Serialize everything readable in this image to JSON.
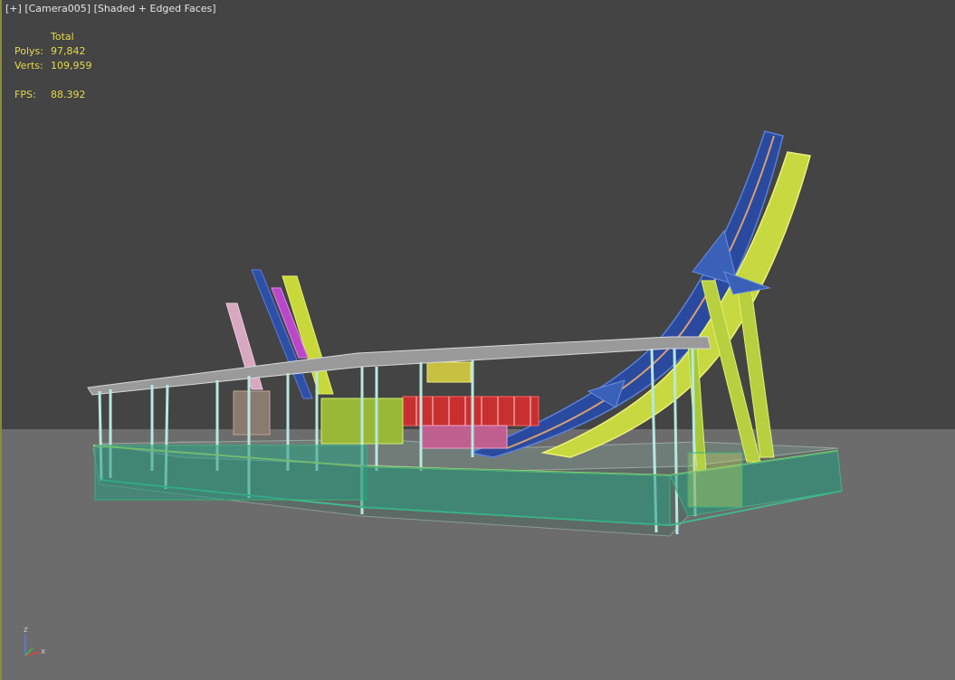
{
  "viewport": {
    "label_plus": "[+]",
    "label_camera": "[Camera005]",
    "label_shading": "[Shaded + Edged Faces]"
  },
  "stats": {
    "header": "Total",
    "polys_key": "Polys:",
    "polys_value": "97,842",
    "verts_key": "Verts:",
    "verts_value": "109,959",
    "fps_key": "FPS:",
    "fps_value": "88.392"
  },
  "axis_gizmo": {
    "z_label": "z",
    "x_label": "x"
  },
  "colors": {
    "background": "#444444",
    "ground": "#6c6c6c",
    "stats_text": "#e5d84c",
    "label_text": "#e6e6e6"
  }
}
